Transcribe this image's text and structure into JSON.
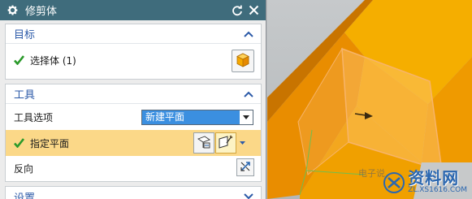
{
  "dialog": {
    "title": "修剪体"
  },
  "sections": {
    "target": {
      "label": "目标",
      "select_body": "选择体 (1)"
    },
    "tool": {
      "label": "工具",
      "tool_option_label": "工具选项",
      "tool_option_value": "新建平面",
      "specify_plane": "指定平面",
      "reverse": "反向"
    },
    "settings": {
      "label": "设置"
    }
  },
  "watermark": {
    "main": "资料网",
    "sub": "ZL.XS1616.COM",
    "faint": "电子说"
  },
  "colors": {
    "titlebar": "#3f6c7c",
    "section_header": "#2c5aa8",
    "highlight_row": "#fbd888",
    "selected_option": "#3b8fe0",
    "solid_body": "#f5a800",
    "solid_body_shade": "#e68a00",
    "check": "#2b9a2b"
  },
  "icons": {
    "title": "gear-icon",
    "reset": "reset-icon",
    "close": "close-icon",
    "section_toggle": "chevron-up-icon",
    "collapsed_toggle": "chevron-down-icon",
    "select_body": "solid-body-icon",
    "plane_dialog": "plane-dialog-icon",
    "plane_inferred": "plane-inferred-icon",
    "reverse": "reverse-direction-icon",
    "status": "check-icon"
  }
}
